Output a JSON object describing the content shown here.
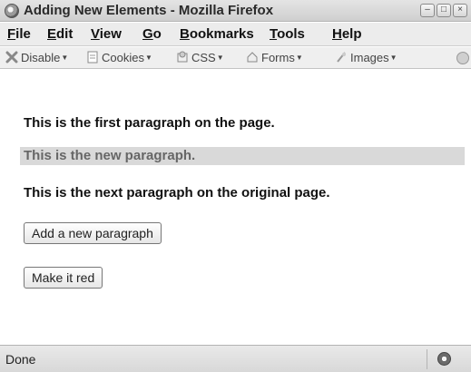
{
  "window": {
    "title": "Adding New Elements - Mozilla Firefox",
    "buttons": {
      "minimize": "–",
      "maximize": "□",
      "close": "×"
    }
  },
  "menubar": {
    "items": [
      "File",
      "Edit",
      "View",
      "Go",
      "Bookmarks",
      "Tools",
      "Help"
    ]
  },
  "toolbar": {
    "items": [
      {
        "label": "Disable",
        "icon": "disable-icon"
      },
      {
        "label": "Cookies",
        "icon": "cookies-icon"
      },
      {
        "label": "CSS",
        "icon": "css-icon"
      },
      {
        "label": "Forms",
        "icon": "forms-icon"
      },
      {
        "label": "Images",
        "icon": "images-icon"
      }
    ]
  },
  "content": {
    "paragraph_first": "This is the first paragraph on the page.",
    "paragraph_new": "This is the new paragraph.",
    "paragraph_next": "This is the next paragraph on the original page.",
    "add_button_label": "Add a new paragraph",
    "red_button_label": "Make it red"
  },
  "status": {
    "text": "Done"
  }
}
